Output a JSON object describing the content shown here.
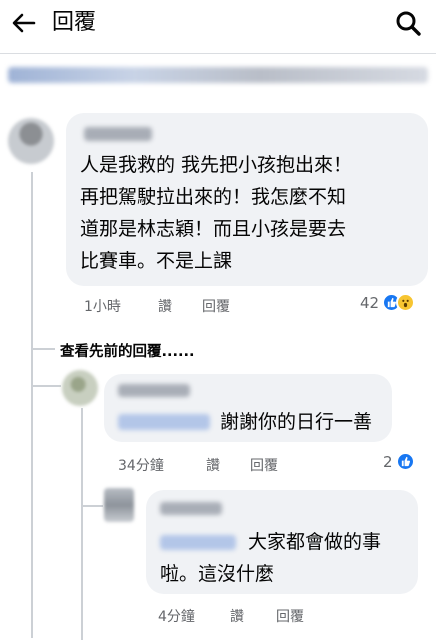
{
  "header": {
    "title": "回覆"
  },
  "comments": [
    {
      "text_lines": [
        "人是我救的 我先把小孩抱出來！",
        "再把駕駛拉出來的！我怎麼不知",
        "道那是林志穎！而且小孩是要去",
        "比賽車。不是上課"
      ],
      "time": "1小時",
      "like_label": "讚",
      "reply_label": "回覆",
      "reaction_count": "42"
    }
  ],
  "more_replies_label": "查看先前的回覆......",
  "replies": [
    {
      "text_lines": [
        "謝謝你的日行一善"
      ],
      "time": "34分鐘",
      "like_label": "讚",
      "reply_label": "回覆",
      "reaction_count": "2"
    },
    {
      "text_lines": [
        "大家都會做的事",
        "啦。這沒什麼"
      ],
      "time": "4分鐘",
      "like_label": "讚",
      "reply_label": "回覆"
    }
  ],
  "colors": {
    "like": "#1877f2",
    "wow": "#f7c531",
    "bubble": "#f0f2f5",
    "meta_text": "#65676b"
  }
}
